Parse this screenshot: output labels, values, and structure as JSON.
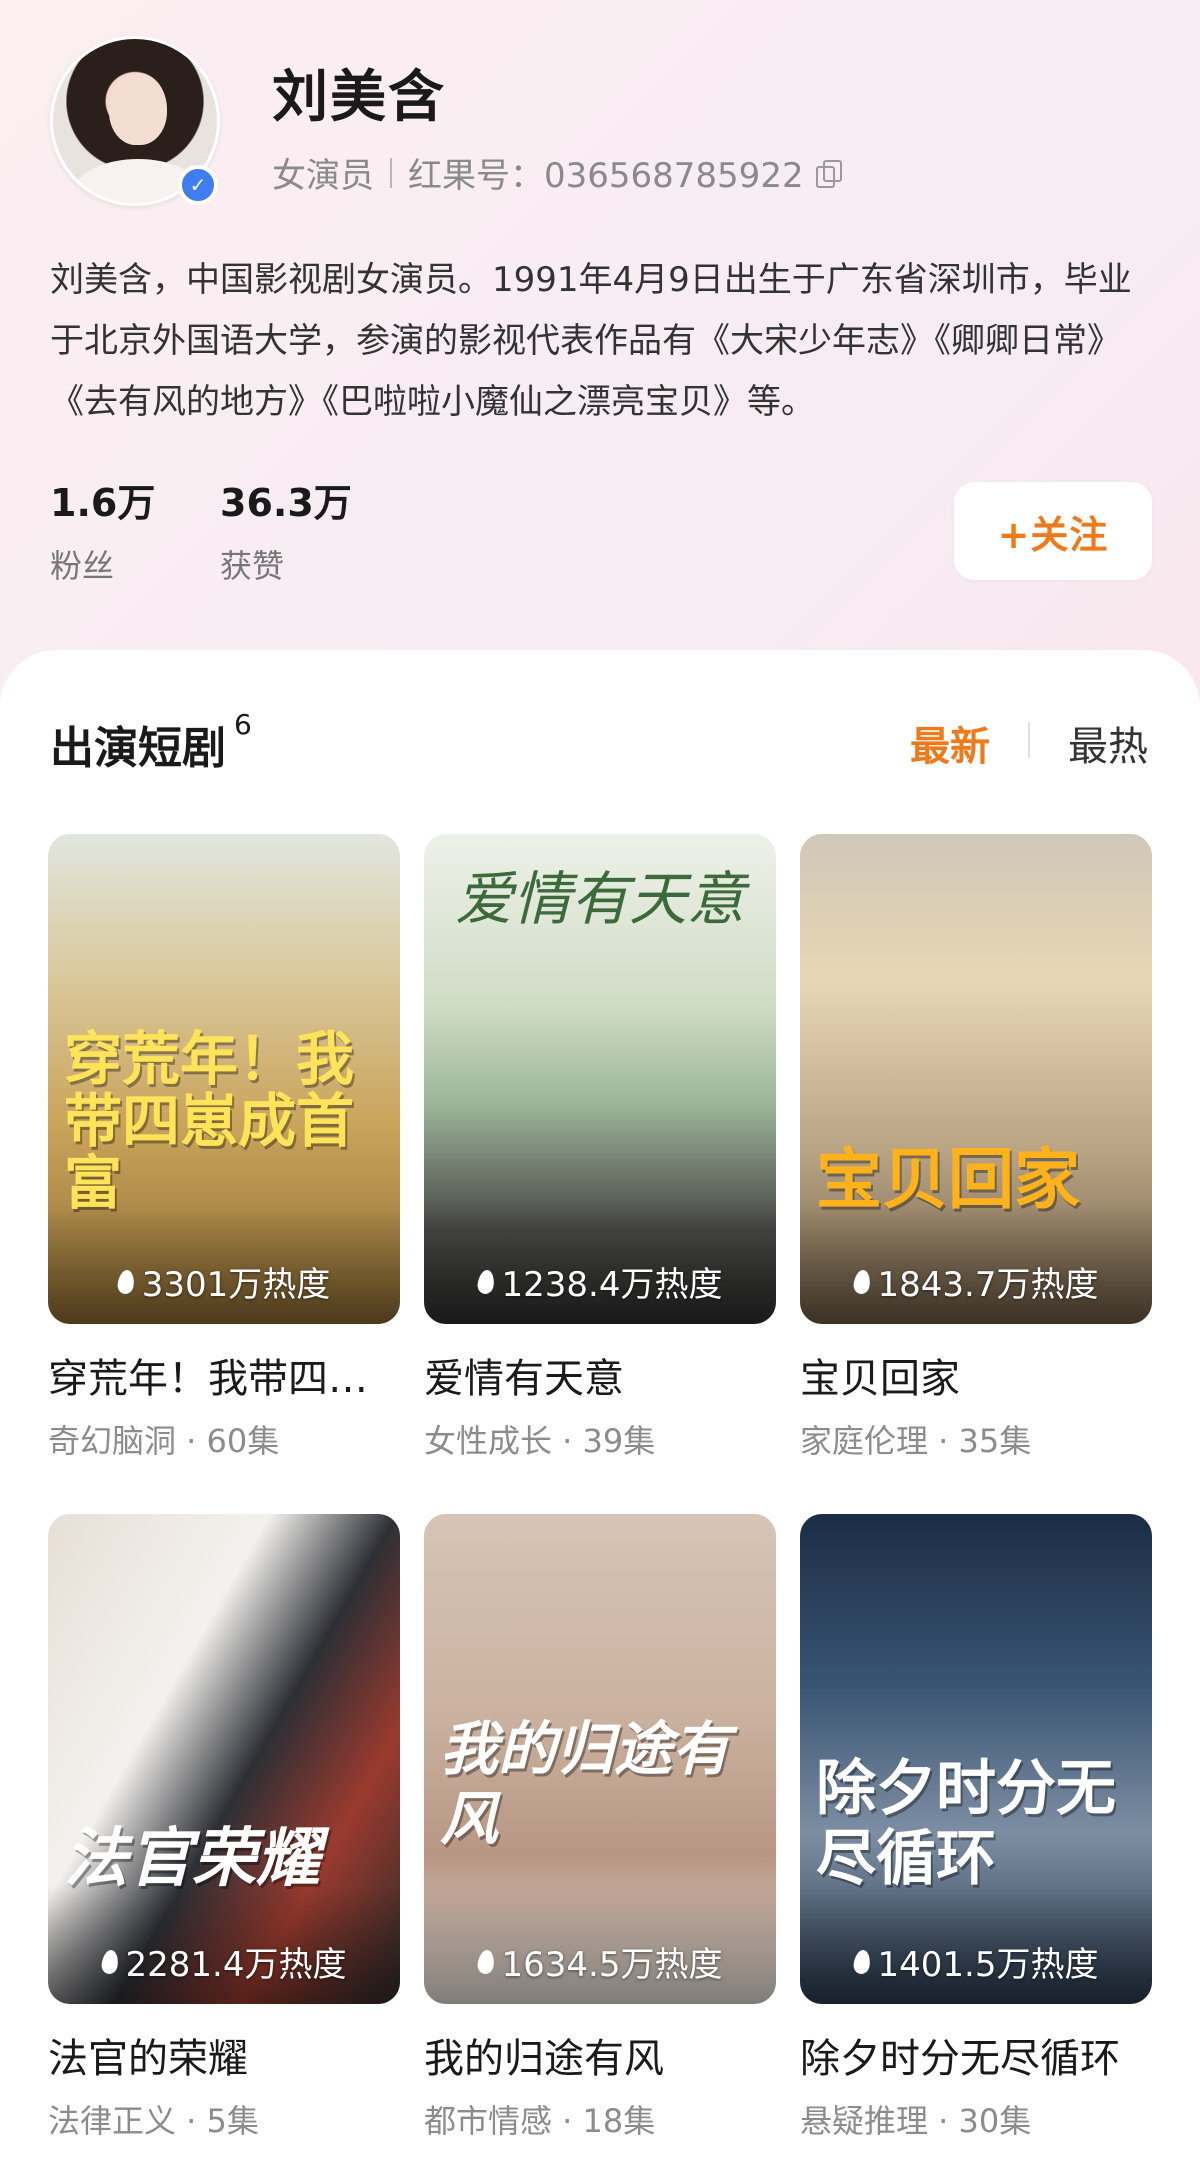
{
  "profile": {
    "name": "刘美含",
    "role": "女演员",
    "id_label": "红果号：036568785922",
    "bio": "刘美含，中国影视剧女演员。1991年4月9日出生于广东省深圳市，毕业于北京外国语大学，参演的影视代表作品有《大宋少年志》《卿卿日常》《去有风的地方》《巴啦啦小魔仙之漂亮宝贝》等。",
    "fans_value": "1.6万",
    "fans_label": "粉丝",
    "likes_value": "36.3万",
    "likes_label": "获赞",
    "follow_label": "+关注"
  },
  "section": {
    "title": "出演短剧",
    "count": "6",
    "sort_newest": "最新",
    "sort_hottest": "最热"
  },
  "dramas": [
    {
      "poster_text": "穿荒年！我带四崽成首富",
      "heat": "3301万热度",
      "title": "穿荒年！我带四崽成首富",
      "meta": "奇幻脑洞 · 60集"
    },
    {
      "poster_text": "爱情有天意",
      "heat": "1238.4万热度",
      "title": "爱情有天意",
      "meta": "女性成长 · 39集"
    },
    {
      "poster_text": "宝贝回家",
      "heat": "1843.7万热度",
      "title": "宝贝回家",
      "meta": "家庭伦理 · 35集"
    },
    {
      "poster_text": "法官荣耀",
      "heat": "2281.4万热度",
      "title": "法官的荣耀",
      "meta": "法律正义 · 5集"
    },
    {
      "poster_text": "我的归途有风",
      "heat": "1634.5万热度",
      "title": "我的归途有风",
      "meta": "都市情感 · 18集"
    },
    {
      "poster_text": "除夕时分无尽循环",
      "heat": "1401.5万热度",
      "title": "除夕时分无尽循环",
      "meta": "悬疑推理 · 30集"
    }
  ],
  "colors": {
    "accent": "#ef7a1c",
    "verify": "#3f7df0"
  }
}
